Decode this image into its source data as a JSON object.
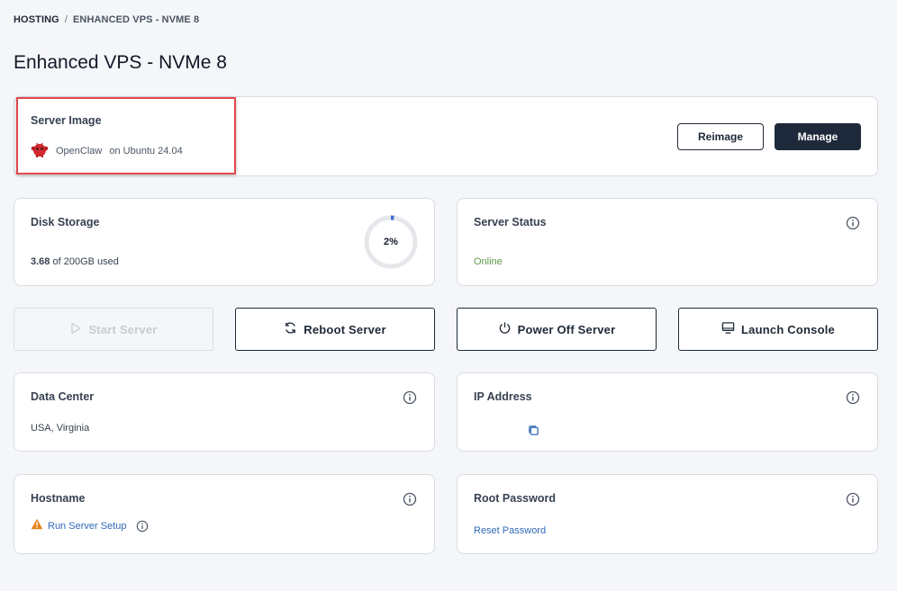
{
  "breadcrumb": {
    "root": "HOSTING",
    "separator": "/",
    "current": "ENHANCED VPS - NVME 8"
  },
  "page": {
    "title": "Enhanced VPS - NVMe 8"
  },
  "server_image": {
    "title": "Server Image",
    "os_name": "OpenClaw",
    "os_base": "on Ubuntu 24.04",
    "reimage_label": "Reimage",
    "manage_label": "Manage"
  },
  "disk": {
    "title": "Disk Storage",
    "used": "3.68",
    "total_text": "of 200GB used",
    "percent_label": "2%",
    "percent": 2
  },
  "status": {
    "title": "Server Status",
    "value": "Online"
  },
  "actions": {
    "start": "Start Server",
    "reboot": "Reboot Server",
    "power_off": "Power Off Server",
    "console": "Launch Console"
  },
  "datacenter": {
    "title": "Data Center",
    "value": "USA, Virginia"
  },
  "ip": {
    "title": "IP Address"
  },
  "hostname": {
    "title": "Hostname",
    "setup_link": "Run Server Setup"
  },
  "root_password": {
    "title": "Root Password",
    "reset_link": "Reset Password"
  },
  "colors": {
    "accent": "#1e293b",
    "link": "#2f6ab7",
    "online": "#5b9a4b",
    "warning": "#e8821e",
    "highlight": "#e0474c",
    "progress": "#3b6fd4"
  }
}
